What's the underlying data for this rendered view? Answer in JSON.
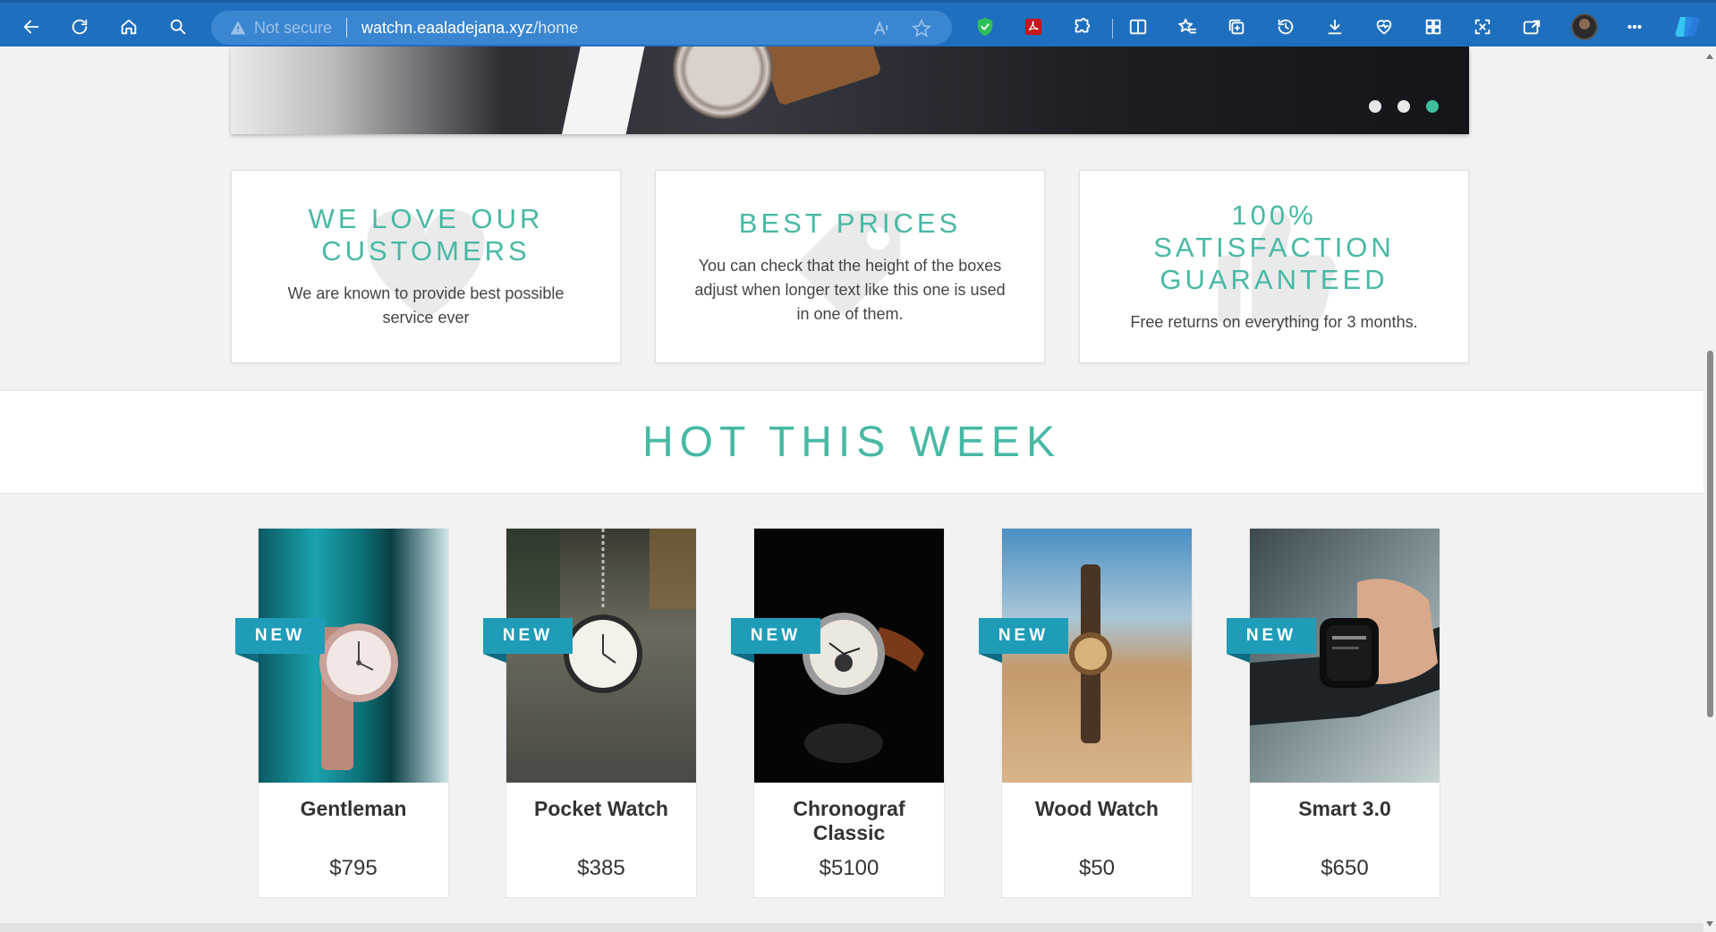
{
  "browser": {
    "security_label": "Not secure",
    "url_host": "watchn.eaaladejana.xyz",
    "url_path": "/home"
  },
  "carousel": {
    "slide_count": 3,
    "active_slide": 3
  },
  "features": [
    {
      "title": "WE LOVE OUR CUSTOMERS",
      "text": "We are known to provide best possible service ever",
      "icon": "heart-icon"
    },
    {
      "title": "BEST PRICES",
      "text": "You can check that the height of the boxes adjust when longer text like this one is used in one of them.",
      "icon": "price-tag-icon"
    },
    {
      "title": "100% SATISFACTION GUARANTEED",
      "text": "Free returns on everything for 3 months.",
      "icon": "thumbs-up-icon"
    }
  ],
  "section": {
    "title": "HOT THIS WEEK"
  },
  "products": [
    {
      "badge": "NEW",
      "name": "Gentleman",
      "price": "$795"
    },
    {
      "badge": "NEW",
      "name": "Pocket Watch",
      "price": "$385"
    },
    {
      "badge": "NEW",
      "name": "Chronograf Classic",
      "price": "$5100"
    },
    {
      "badge": "NEW",
      "name": "Wood Watch",
      "price": "$50"
    },
    {
      "badge": "NEW",
      "name": "Smart 3.0",
      "price": "$650"
    }
  ],
  "colors": {
    "accent": "#47b9a5",
    "badge": "#1f9db8",
    "toolbar": "#1f6fbf"
  }
}
